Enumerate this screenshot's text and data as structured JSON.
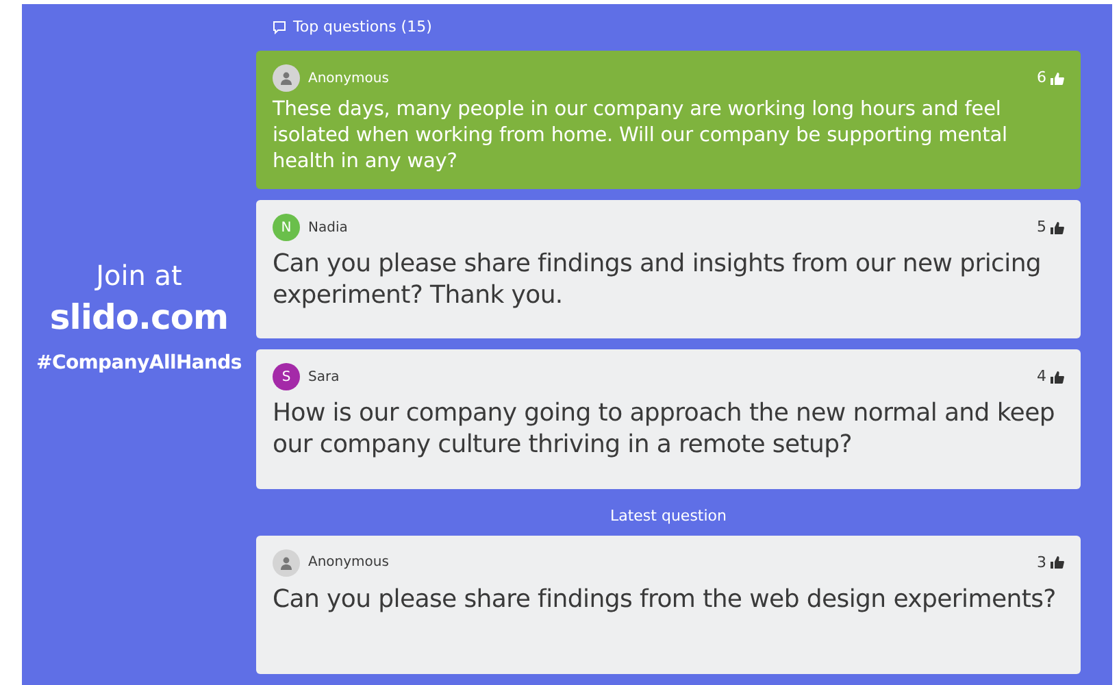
{
  "join": {
    "prompt": "Join at",
    "site": "slido.com",
    "hashtag": "#CompanyAllHands"
  },
  "top_questions": {
    "title": "Top questions (15)",
    "questions": [
      {
        "author": "Anonymous",
        "avatar": {
          "kind": "anonymous"
        },
        "votes": "6",
        "highlighted": true,
        "text": "These days, many people in our company are working long hours and feel isolated when working from home. Will our company be supporting mental health in any way?"
      },
      {
        "author": "Nadia",
        "avatar": {
          "kind": "initial",
          "initial": "N",
          "color": "#6abf4b"
        },
        "votes": "5",
        "highlighted": false,
        "text": "Can you please share findings and insights from our new pricing experiment? Thank you."
      },
      {
        "author": "Sara",
        "avatar": {
          "kind": "initial",
          "initial": "S",
          "color": "#a42aa8"
        },
        "votes": "4",
        "highlighted": false,
        "text": "How is our company going to approach the new normal and keep our company culture thriving in a remote setup?"
      }
    ]
  },
  "latest": {
    "title": "Latest question",
    "questions": [
      {
        "author": "Anonymous",
        "avatar": {
          "kind": "anonymous"
        },
        "votes": "3",
        "highlighted": false,
        "text": "Can you please share findings from the web design experiments?"
      }
    ]
  }
}
